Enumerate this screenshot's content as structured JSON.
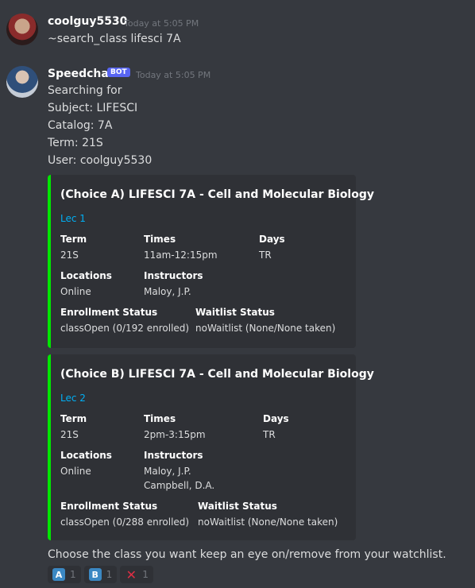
{
  "message1": {
    "username": "coolguy5530",
    "timestamp": "Today at 5:05 PM",
    "content": "~search_class lifesci 7A"
  },
  "message2": {
    "username": "Speedchat",
    "bot_tag": "BOT",
    "timestamp": "Today at 5:05 PM",
    "lines": [
      "Searching for",
      "Subject: LIFESCI",
      "Catalog: 7A",
      "Term: 21S",
      "User: coolguy5530"
    ],
    "footer": "Choose the class you want keep an eye on/remove from your watchlist."
  },
  "embeds": [
    {
      "title": "(Choice A) LIFESCI 7A - Cell and Molecular Biology",
      "link": "Lec 1",
      "term_label": "Term",
      "term": "21S",
      "times_label": "Times",
      "times": "11am-12:15pm",
      "days_label": "Days",
      "days": "TR",
      "locations_label": "Locations",
      "locations": "Online",
      "instructors_label": "Instructors",
      "instructors": [
        "Maloy, J.P."
      ],
      "enrollment_label": "Enrollment Status",
      "enrollment": "classOpen (0/192 enrolled)",
      "waitlist_label": "Waitlist Status",
      "waitlist": "noWaitlist (None/None taken)"
    },
    {
      "title": "(Choice B) LIFESCI 7A - Cell and Molecular Biology",
      "link": "Lec 2",
      "term_label": "Term",
      "term": "21S",
      "times_label": "Times",
      "times": "2pm-3:15pm",
      "days_label": "Days",
      "days": "TR",
      "locations_label": "Locations",
      "locations": "Online",
      "instructors_label": "Instructors",
      "instructors": [
        "Maloy, J.P.",
        "Campbell, D.A."
      ],
      "enrollment_label": "Enrollment Status",
      "enrollment": "classOpen (0/288 enrolled)",
      "waitlist_label": "Waitlist Status",
      "waitlist": "noWaitlist (None/None taken)"
    }
  ],
  "reactions": [
    {
      "emoji": "A",
      "count": "1",
      "color": "#3b88c3"
    },
    {
      "emoji": "B",
      "count": "1",
      "color": "#3b88c3"
    },
    {
      "emoji": "✕",
      "count": "1",
      "color": "#dd2e44"
    }
  ]
}
